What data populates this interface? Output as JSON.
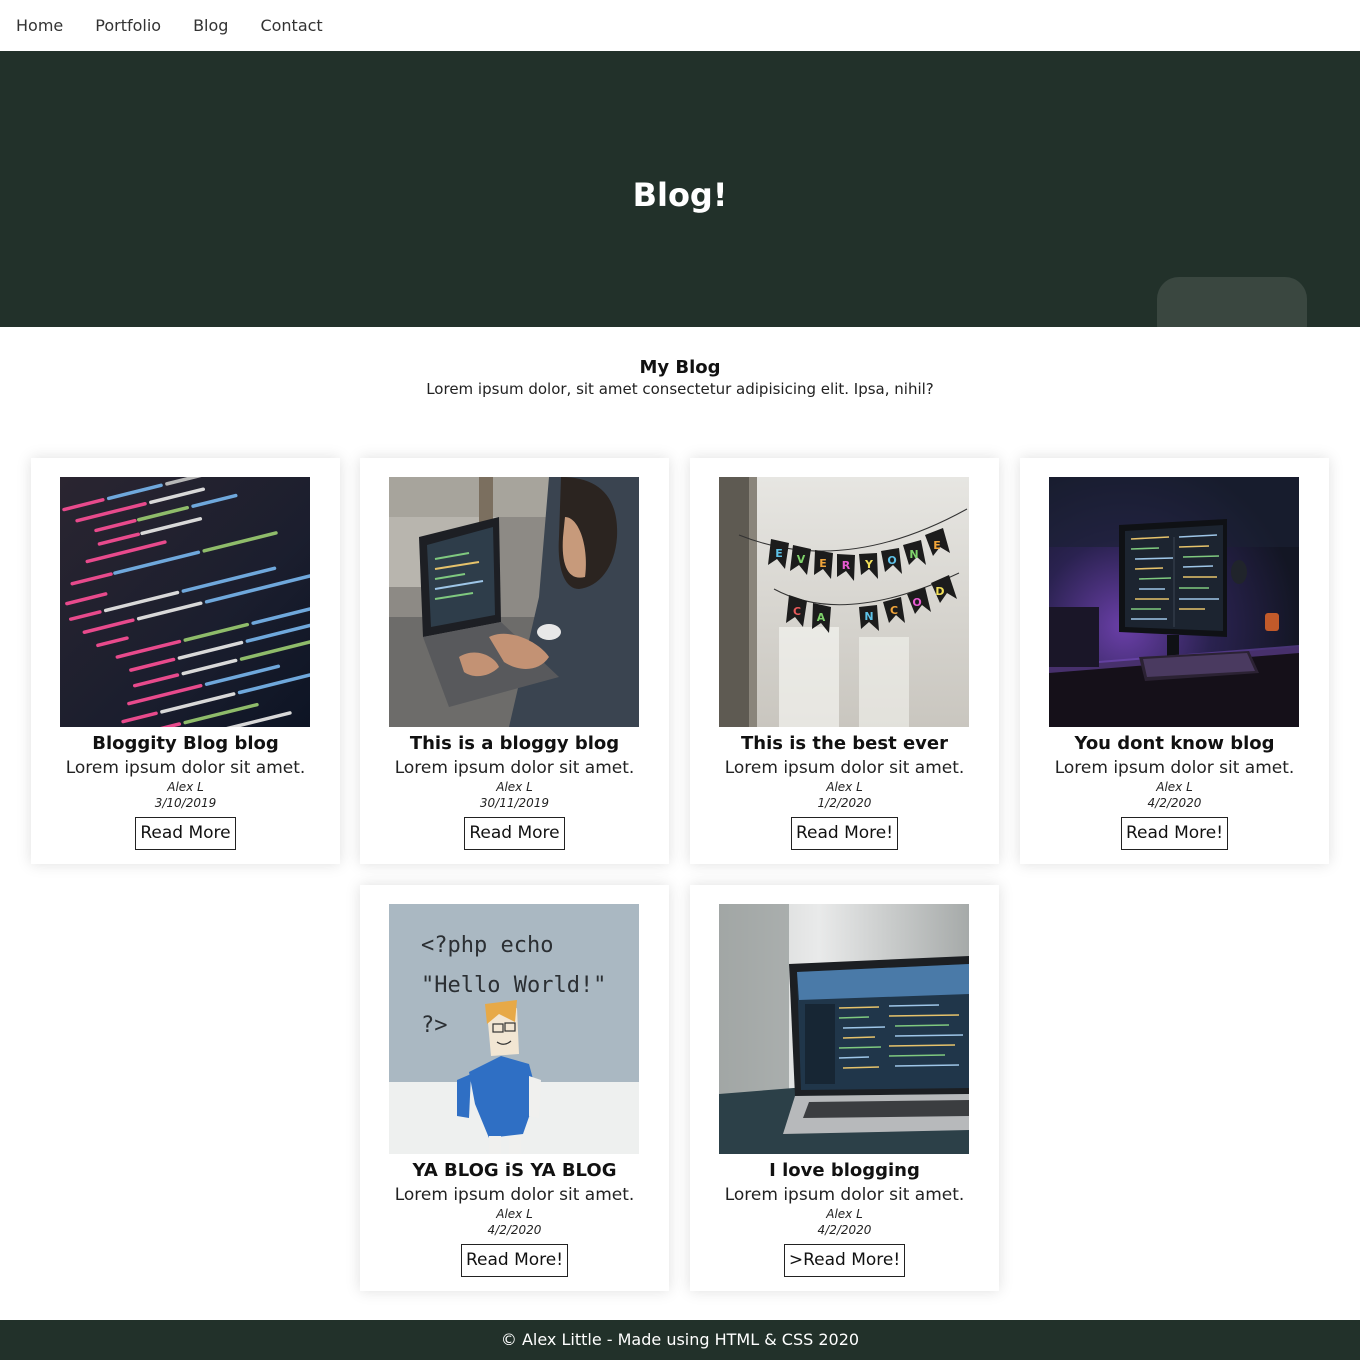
{
  "nav": {
    "items": [
      "Home",
      "Portfolio",
      "Blog",
      "Contact"
    ]
  },
  "hero": {
    "title": "Blog!"
  },
  "intro": {
    "heading": "My Blog",
    "text": "Lorem ipsum dolor, sit amet consectetur adipisicing elit. Ipsa, nihil?"
  },
  "posts": [
    {
      "title": "Bloggity Blog blog",
      "desc": "Lorem ipsum dolor sit amet.",
      "author": "Alex L",
      "date": "3/10/2019",
      "button": "Read More",
      "image": "code-screen-photo"
    },
    {
      "title": "This is a bloggy blog",
      "desc": "Lorem ipsum dolor sit amet.",
      "author": "Alex L",
      "date": "30/11/2019",
      "button": "Read More",
      "image": "man-laptop-photo"
    },
    {
      "title": "This is the best ever",
      "desc": "Lorem ipsum dolor sit amet.",
      "author": "Alex L",
      "date": "1/2/2020",
      "button": "Read More!",
      "image": "banner-photo",
      "image_text": [
        "EVERYONE",
        "CAN CODE!"
      ]
    },
    {
      "title": "You dont know blog",
      "desc": "Lorem ipsum dolor sit amet.",
      "author": "Alex L",
      "date": "4/2/2020",
      "button": "Read More!",
      "image": "monitor-desk-photo"
    },
    {
      "title": "YA BLOG iS YA BLOG",
      "desc": "Lorem ipsum dolor sit amet.",
      "author": "Alex L",
      "date": "4/2/2020",
      "button": "Read More!",
      "image": "paper-figure-photo",
      "image_text": [
        "<?php echo",
        "\"Hello World!\"",
        "?>"
      ]
    },
    {
      "title": "I love blogging",
      "desc": "Lorem ipsum dolor sit amet.",
      "author": "Alex L",
      "date": "4/2/2020",
      "button": ">Read More!",
      "image": "laptop-table-photo"
    }
  ],
  "footer": {
    "text": "© Alex Little - Made using HTML & CSS 2020"
  },
  "colors": {
    "hero_bg": "#22312a",
    "footer_bg": "#22312a",
    "accent_tab": "#3a4740"
  }
}
